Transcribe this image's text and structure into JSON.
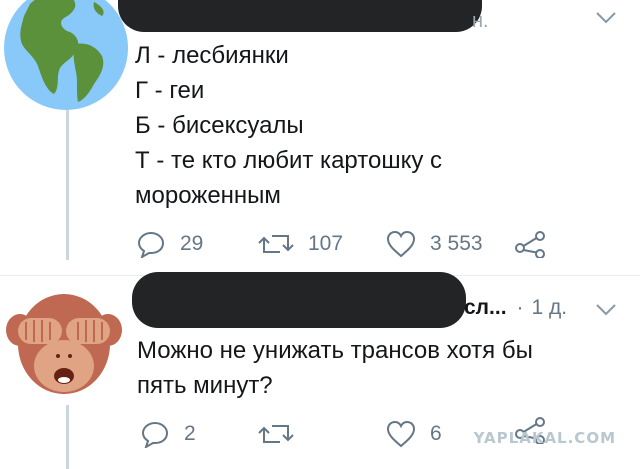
{
  "tweet1": {
    "header_tail": "н.",
    "lines": [
      "Л - лесбиянки",
      "Г - геи",
      "Б - бисексуалы",
      "Т - те кто любит картошку с",
      "мороженным"
    ],
    "reply_count": "29",
    "retweet_count": "107",
    "like_count": "3 553"
  },
  "tweet2": {
    "handle_tail": "сл...",
    "separator": "·",
    "time": "1 д.",
    "lines": [
      "Можно не унижать трансов хотя бы",
      "пять минут?"
    ],
    "reply_count": "2",
    "like_count": "6"
  },
  "watermark": "YAPLAKAL.COM",
  "icons": {
    "avatar1": "globe-americas-avatar",
    "avatar2": "see-no-evil-monkey-avatar",
    "menu": "chevron-down-icon",
    "reply": "reply-bubble-icon",
    "retweet": "retweet-icon",
    "like": "heart-icon",
    "share": "share-icon"
  }
}
